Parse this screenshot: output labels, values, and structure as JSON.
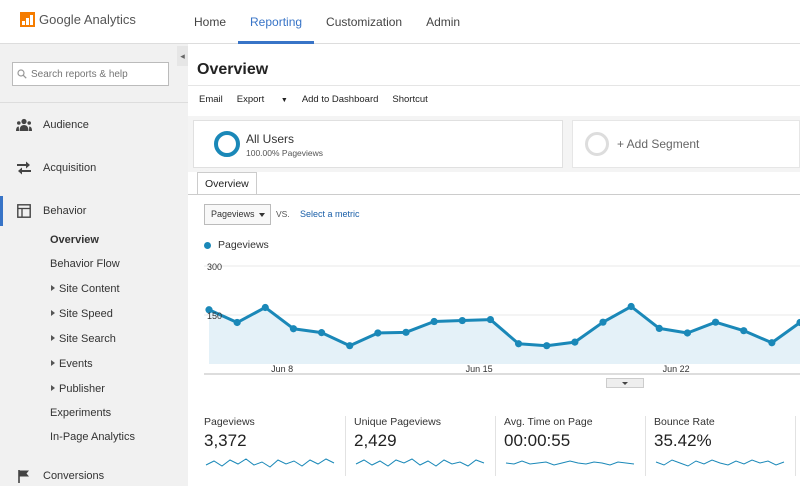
{
  "app": {
    "title": "Google Analytics"
  },
  "topnav": {
    "tabs": [
      "Home",
      "Reporting",
      "Customization",
      "Admin"
    ],
    "active": "Reporting"
  },
  "sidebar": {
    "search_placeholder": "Search reports & help",
    "sections": [
      {
        "label": "Audience",
        "icon": "people-icon"
      },
      {
        "label": "Acquisition",
        "icon": "arrows-icon"
      },
      {
        "label": "Behavior",
        "icon": "layout-icon"
      },
      {
        "label": "Conversions",
        "icon": "flag-icon"
      }
    ],
    "behavior_items": [
      "Overview",
      "Behavior Flow",
      "Site Content",
      "Site Speed",
      "Site Search",
      "Events",
      "Publisher",
      "Experiments",
      "In-Page Analytics"
    ]
  },
  "page": {
    "title": "Overview",
    "subtab": "Overview"
  },
  "actions": [
    "Email",
    "Export",
    "Add to Dashboard",
    "Shortcut"
  ],
  "segments": {
    "name": "All Users",
    "subtitle": "100.00% Pageviews",
    "add_label": "+ Add Segment"
  },
  "controls": {
    "metric": "Pageviews",
    "vs": "VS.",
    "select_metric": "Select a metric"
  },
  "chart_data": {
    "type": "area",
    "series": [
      {
        "name": "Pageviews",
        "values": [
          166,
          127,
          173,
          108,
          96,
          56,
          95,
          97,
          130,
          133,
          136,
          62,
          56,
          67,
          128,
          176,
          109,
          95,
          128,
          102,
          65,
          127
        ]
      }
    ],
    "y_ticks": [
      "300",
      "150"
    ],
    "ylim": [
      0,
      300
    ],
    "x_tick_labels": [
      {
        "label": "Jun 8",
        "index": 2
      },
      {
        "label": "Jun 15",
        "index": 9
      },
      {
        "label": "Jun 22",
        "index": 16
      }
    ],
    "color": "#1a88b8",
    "fill": "#e4f1f8"
  },
  "stats": [
    {
      "label": "Pageviews",
      "value": "3,372"
    },
    {
      "label": "Unique Pageviews",
      "value": "2,429"
    },
    {
      "label": "Avg. Time on Page",
      "value": "00:00:55"
    },
    {
      "label": "Bounce Rate",
      "value": "35.42%"
    }
  ]
}
